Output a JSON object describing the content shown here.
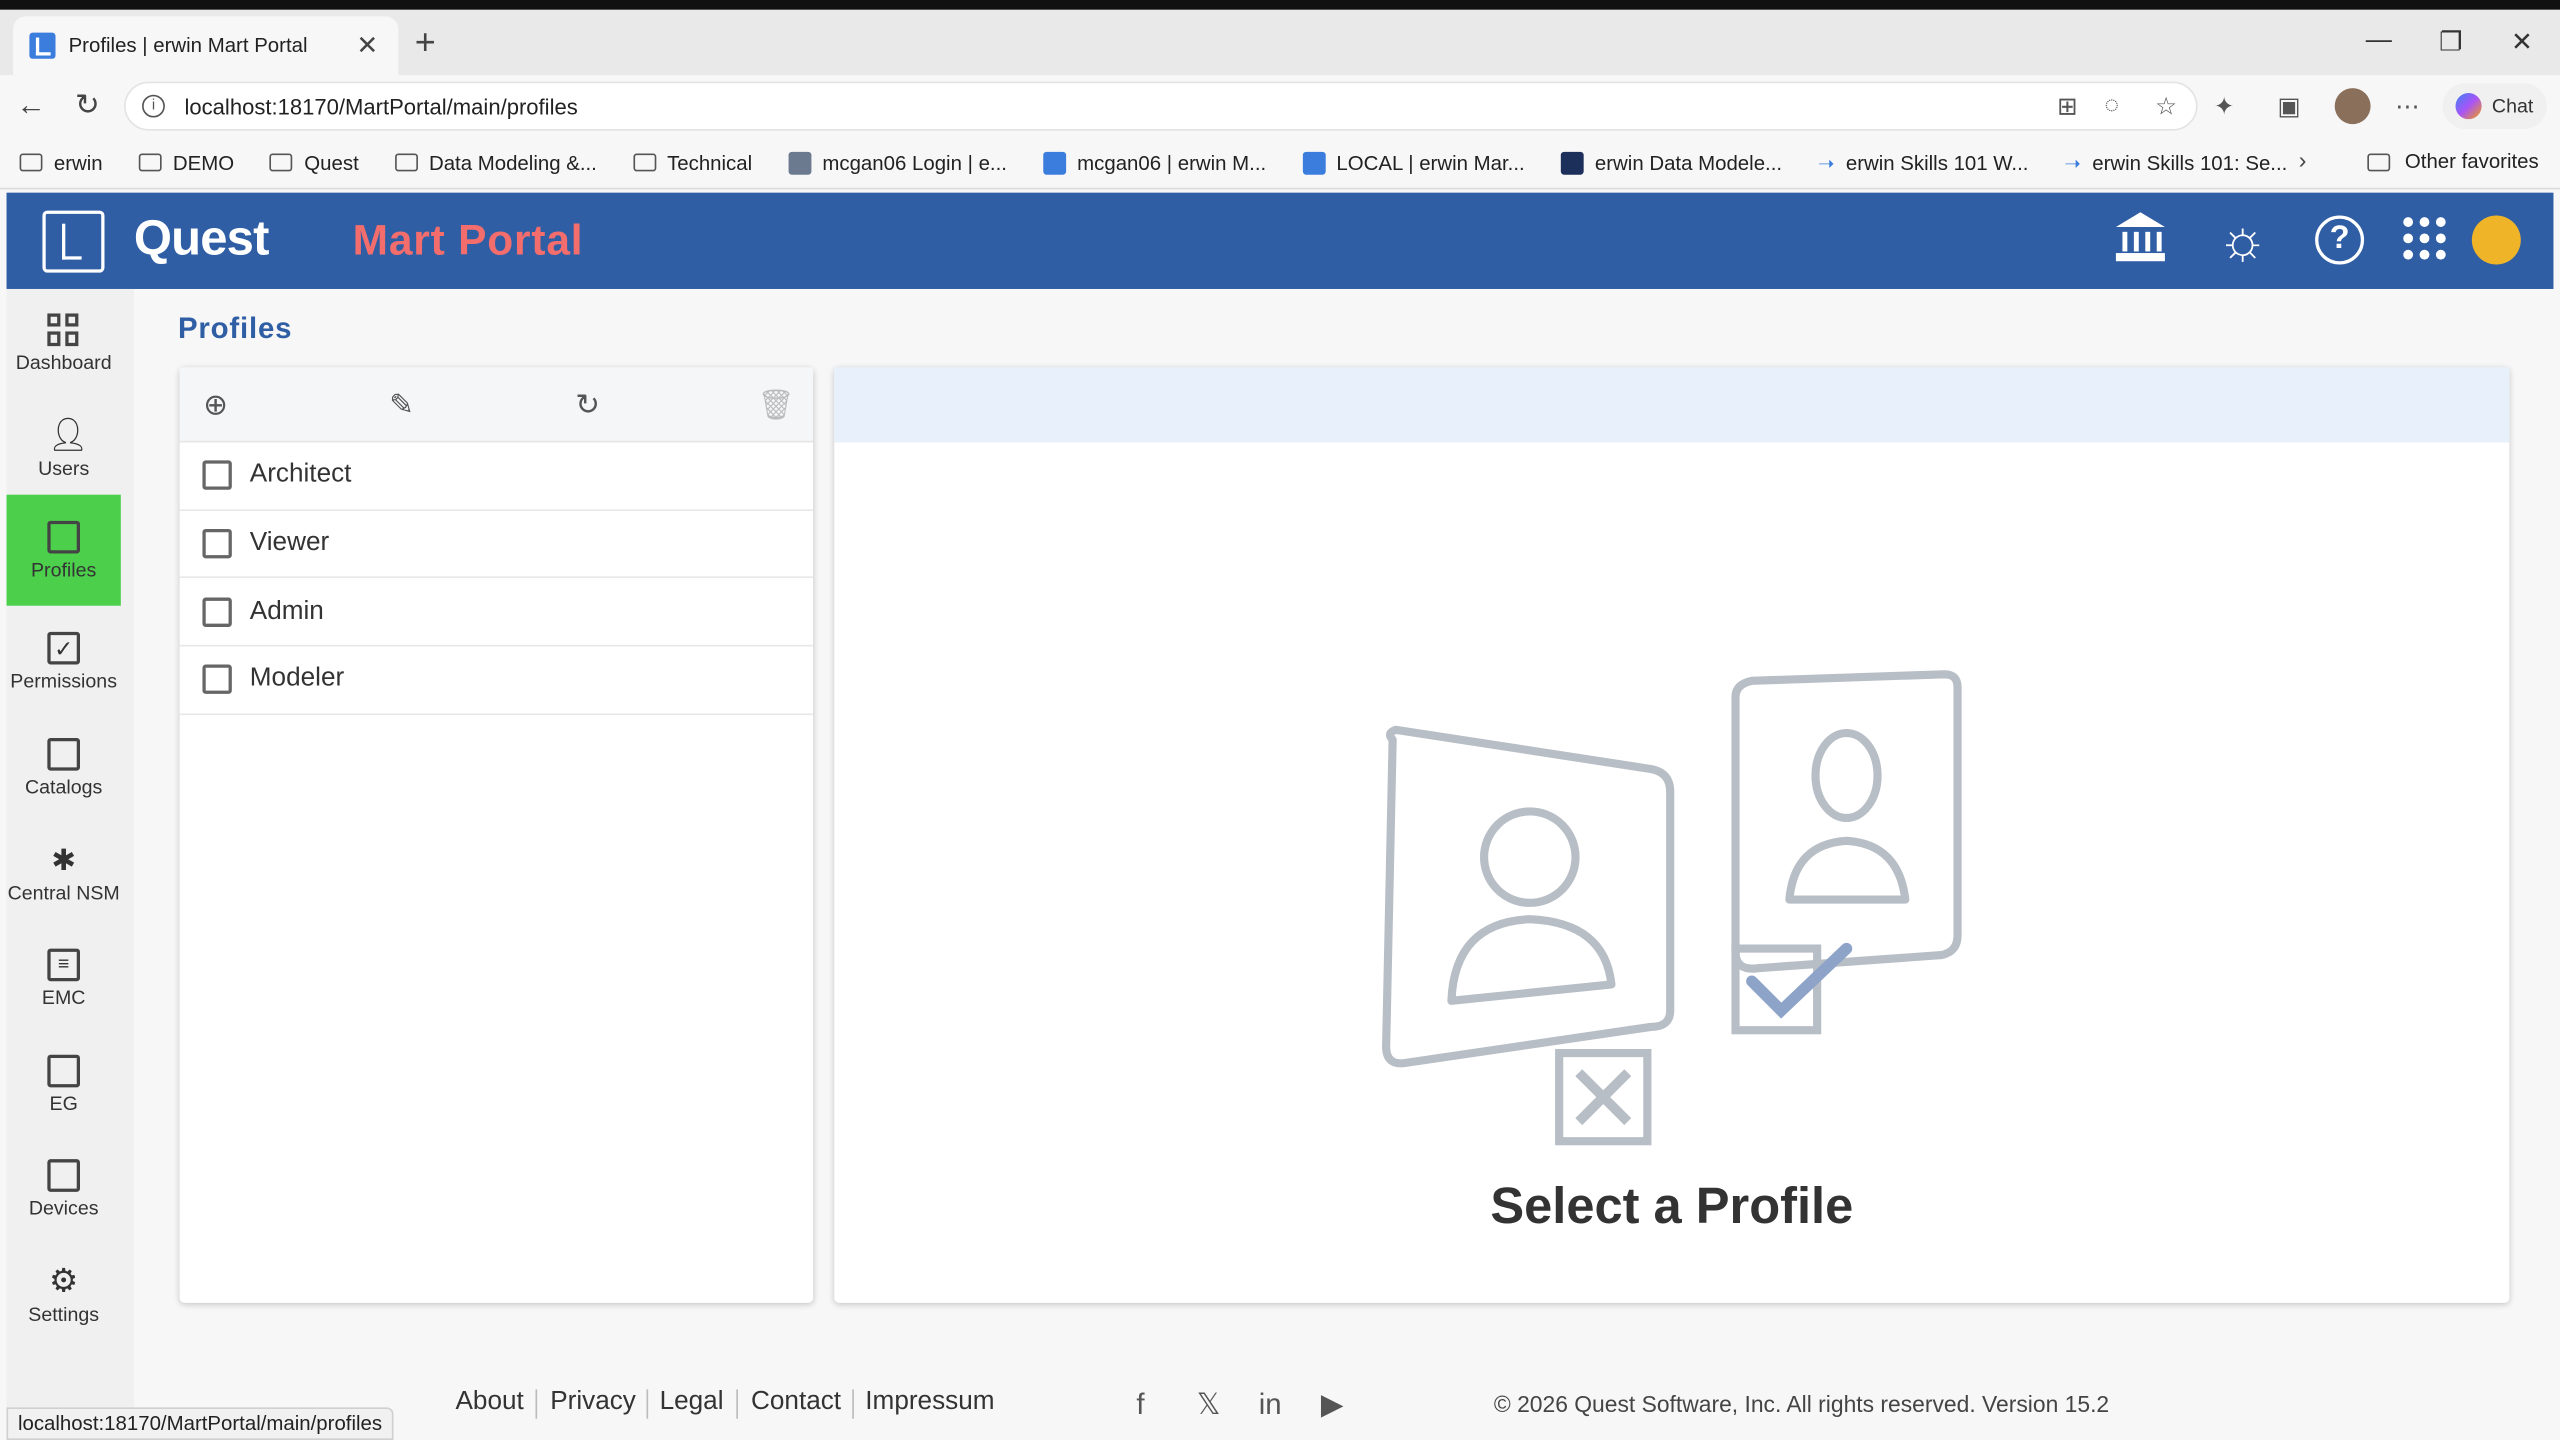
{
  "browser": {
    "tab_title": "Profiles | erwin Mart Portal",
    "tab_close": "✕",
    "new_tab": "+",
    "url": "localhost:18170/MartPortal/main/profiles",
    "chat_label": "Chat",
    "bookmarks": [
      "erwin",
      "DEMO",
      "Quest",
      "Data Modeling &...",
      "Technical",
      "mcgan06 Login | e...",
      "mcgan06 | erwin M...",
      "LOCAL | erwin Mar...",
      "erwin Data Modele...",
      "erwin Skills 101 W...",
      "erwin Skills 101: Se..."
    ],
    "other_favorites": "Other favorites",
    "status_url": "localhost:18170/MartPortal/main/profiles"
  },
  "header": {
    "brand": "Quest",
    "product": "Mart Portal",
    "help": "?"
  },
  "sidebar": {
    "items": [
      {
        "label": "Dashboard"
      },
      {
        "label": "Users"
      },
      {
        "label": "Profiles"
      },
      {
        "label": "Permissions"
      },
      {
        "label": "Catalogs"
      },
      {
        "label": "Central NSM"
      },
      {
        "label": "EMC"
      },
      {
        "label": "EG"
      },
      {
        "label": "Devices"
      },
      {
        "label": "Settings"
      }
    ],
    "active": "Profiles"
  },
  "main": {
    "title": "Profiles",
    "profiles": [
      "Architect",
      "Viewer",
      "Admin",
      "Modeler"
    ],
    "empty_message": "Select a Profile"
  },
  "footer": {
    "links": [
      "About",
      "Privacy",
      "Legal",
      "Contact",
      "Impressum"
    ],
    "copyright": "© 2026 Quest Software, Inc. All rights reserved. Version 15.2"
  },
  "colors": {
    "header_bg": "#2f5ea5",
    "product_accent": "#f36d6d",
    "active_nav": "#4cd04c"
  }
}
